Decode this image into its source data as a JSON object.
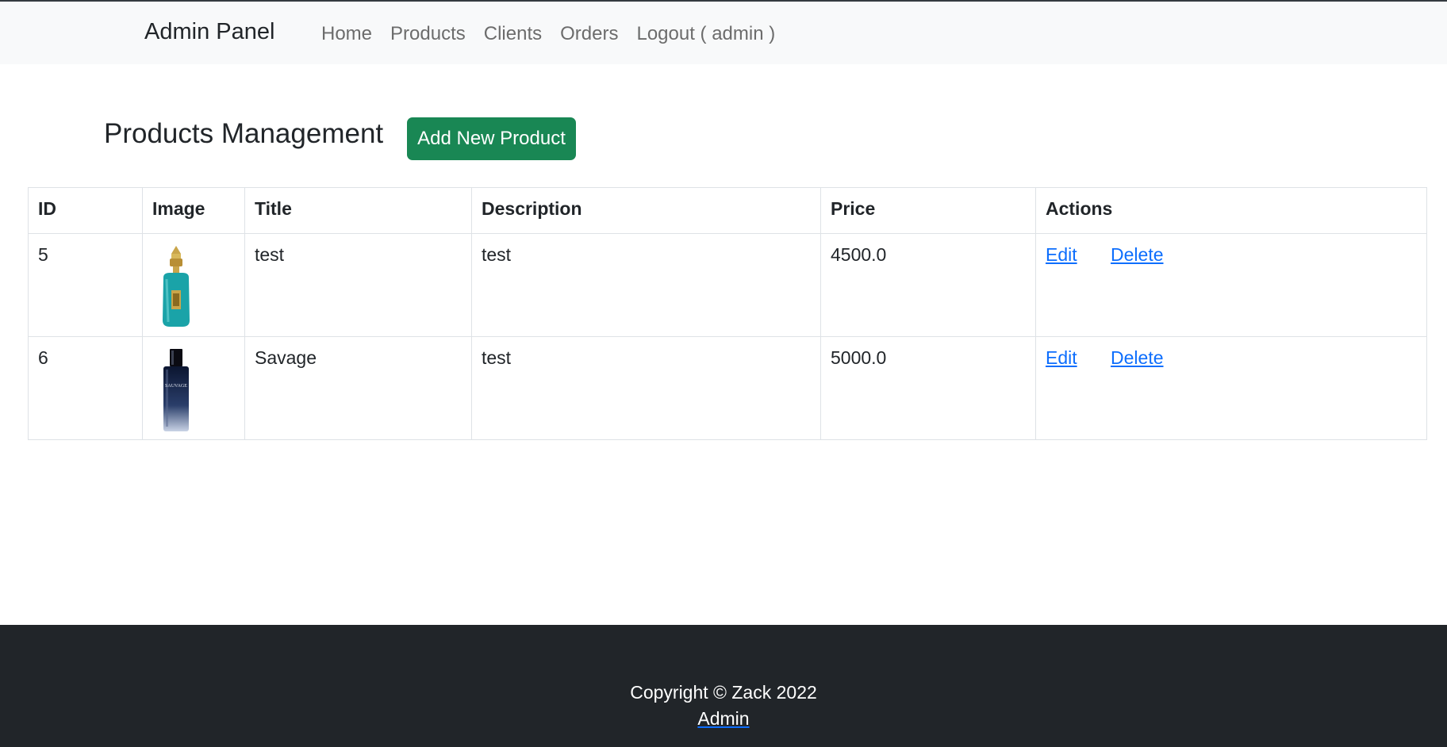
{
  "navbar": {
    "brand": "Admin Panel",
    "links": [
      "Home",
      "Products",
      "Clients",
      "Orders",
      "Logout ( admin )"
    ]
  },
  "page": {
    "title": "Products Management",
    "add_button": "Add New Product"
  },
  "table": {
    "headers": [
      "ID",
      "Image",
      "Title",
      "Description",
      "Price",
      "Actions"
    ],
    "rows": [
      {
        "id": "5",
        "image": "teal-perfume-bottle",
        "title": "test",
        "description": "test",
        "price": "4500.0",
        "edit": "Edit",
        "delete": "Delete"
      },
      {
        "id": "6",
        "image": "sauvage-perfume-bottle",
        "image_text": "SAUVAGE",
        "title": "Savage",
        "description": "test",
        "price": "5000.0",
        "edit": "Edit",
        "delete": "Delete"
      }
    ]
  },
  "footer": {
    "copyright": "Copyright © Zack 2022",
    "link": "Admin"
  },
  "colors": {
    "navbar_bg": "#f8f9fa",
    "success": "#198754",
    "link": "#0d6efd",
    "footer_bg": "#212529"
  }
}
